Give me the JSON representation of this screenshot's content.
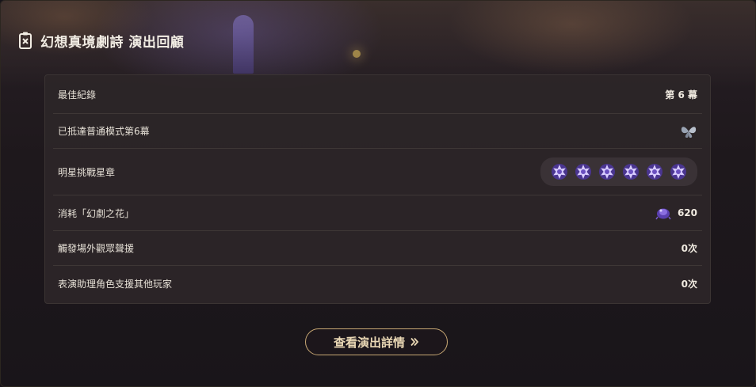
{
  "header": {
    "title": "幻想真境劇詩 演出回顧",
    "icon": "tablet-icon"
  },
  "rows": [
    {
      "label": "最佳紀錄",
      "value": "第 6 幕"
    },
    {
      "label": "已抵達普通模式第6幕",
      "icon": "butterfly-medal-icon"
    },
    {
      "label": "明星挑戰星章",
      "stars_count": 6,
      "icon": "star-badge-icon"
    },
    {
      "label": "消耗「幻劇之花」",
      "value": "620",
      "icon": "purple-flower-icon"
    },
    {
      "label": "觸發場外觀眾聲援",
      "value": "0次"
    },
    {
      "label": "表演助理角色支援其他玩家",
      "value": "0次"
    }
  ],
  "cta": {
    "label": "查看演出詳情",
    "icon": "double-chevron-right-icon"
  },
  "colors": {
    "accent_gold": "#c8a874",
    "star_purple": "#6a4fc0",
    "panel": "#2c2628"
  }
}
